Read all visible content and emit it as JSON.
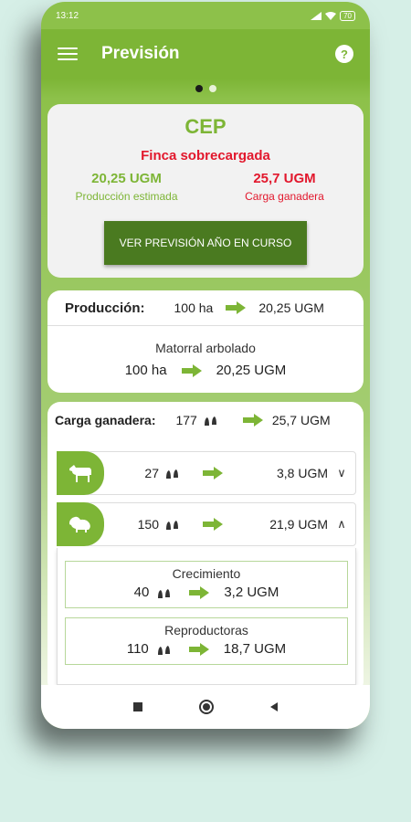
{
  "status": {
    "time": "13:12",
    "battery": "70"
  },
  "appbar": {
    "title": "Previsión",
    "help": "?"
  },
  "summary": {
    "code": "CEP",
    "alert": "Finca sobrecargada",
    "production_value": "20,25 UGM",
    "production_label": "Producción estimada",
    "load_value": "25,7 UGM",
    "load_label": "Carga ganadera",
    "button": "VER PREVISIÓN AÑO EN CURSO"
  },
  "production": {
    "label": "Producción:",
    "area": "100 ha",
    "ugm": "20,25 UGM",
    "vegetation": {
      "name": "Matorral arbolado",
      "area": "100 ha",
      "ugm": "20,25 UGM"
    }
  },
  "load": {
    "label": "Carga ganadera:",
    "count": "177",
    "ugm": "25,7 UGM",
    "animals": [
      {
        "icon": "goat-icon",
        "count": "27",
        "ugm": "3,8 UGM",
        "chevron": "∨"
      },
      {
        "icon": "pig-icon",
        "count": "150",
        "ugm": "21,9 UGM",
        "chevron": "∧"
      }
    ],
    "groups": [
      {
        "name": "Crecimiento",
        "count": "40",
        "ugm": "3,2 UGM"
      },
      {
        "name": "Reproductoras",
        "count": "110",
        "ugm": "18,7 UGM"
      }
    ]
  },
  "colors": {
    "primary": "#7db536",
    "dark": "#4a7a20",
    "alert": "#e2172c"
  }
}
